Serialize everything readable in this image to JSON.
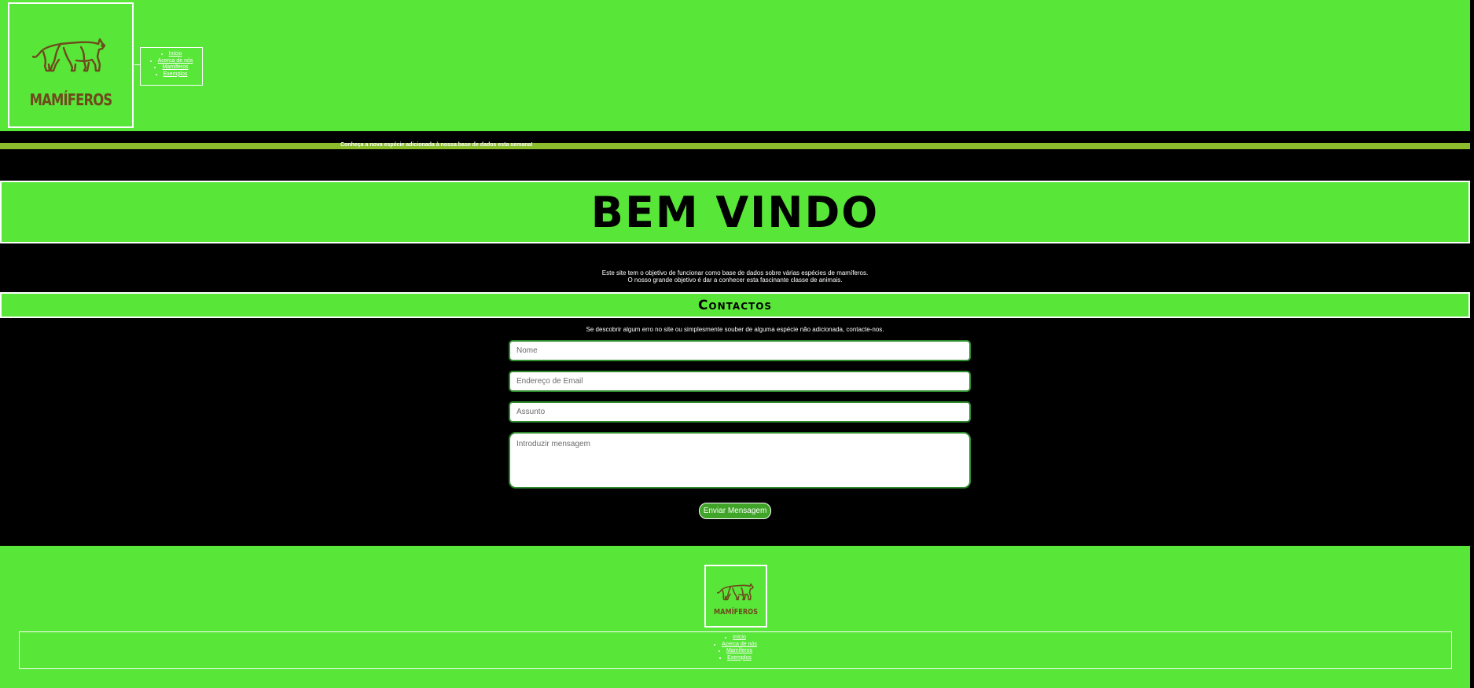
{
  "header": {
    "logo_text": "MAMÍFEROS",
    "nav": [
      "Início",
      "Acerca de nós",
      "Mamíferos",
      "Exemplos"
    ]
  },
  "ticker": {
    "text": "Conheça a nova espécie adicionada à nossa base de dados esta semana!"
  },
  "welcome": {
    "title": "BEM VINDO",
    "line1": "Este site tem o objetivo de funcionar como base de dados sobre várias espécies de mamíferos.",
    "line2": "O nosso grande objetivo é dar a conhecer esta fascinante classe de animais."
  },
  "contact": {
    "title": "Contactos",
    "note": "Se descobrir algum erro no site ou simplesmente souber de alguma espécie não adicionada, contacte-nos.",
    "name_placeholder": "Nome",
    "email_placeholder": "Endereço de Email",
    "subject_placeholder": "Assunto",
    "message_placeholder": "Introduzir mensagem",
    "send_label": "Enviar Mensagem"
  },
  "footer": {
    "logo_text": "MAMÍFEROS",
    "nav": [
      "Início",
      "Acerca de nós",
      "Mamíferos",
      "Exemplos"
    ]
  },
  "colors": {
    "brand_green": "#58e639",
    "ticker_green": "#8bbd2d",
    "button_green": "#3fa428",
    "logo_brown": "#6e4a1c"
  },
  "icons": {
    "logo": "walking-cat-silhouette-icon"
  }
}
